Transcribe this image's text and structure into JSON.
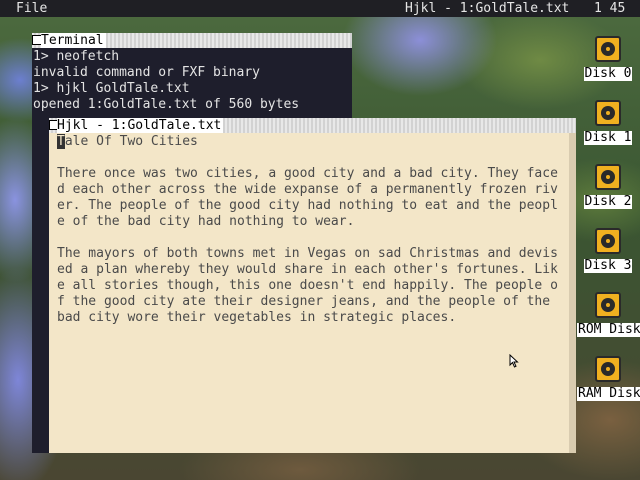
{
  "menubar": {
    "file_label": "File",
    "active_title": "Hjkl - 1:GoldTale.txt",
    "clock": "1 45"
  },
  "desktop_icons": [
    {
      "label": "Disk 0",
      "icon": "disk-icon"
    },
    {
      "label": "Disk 1",
      "icon": "disk-icon"
    },
    {
      "label": "Disk 2",
      "icon": "disk-icon"
    },
    {
      "label": "Disk 3",
      "icon": "disk-icon"
    },
    {
      "label": "ROM Disk",
      "icon": "disk-icon"
    },
    {
      "label": "RAM Disk",
      "icon": "disk-icon"
    }
  ],
  "terminal": {
    "title": "Terminal",
    "lines": [
      "1> neofetch",
      "invalid command or FXF binary",
      "1> hjkl GoldTale.txt",
      "opened 1:GoldTale.txt of 560 bytes"
    ]
  },
  "editor": {
    "title": "Hjkl - 1:GoldTale.txt",
    "cursor_char": "T",
    "first_line_rest": "ale Of Two Cities",
    "lines": [
      "",
      "There once was two cities, a good city and a bad city. They face",
      "d each other across the wide expanse of a permanently frozen riv",
      "er. The people of the good city had nothing to eat and the peopl",
      "e of the bad city had nothing to wear.",
      "",
      "The mayors of both towns met in Vegas on sad Christmas and devis",
      "ed a plan whereby they would share in each other's fortunes. Lik",
      "e all stories though, this one doesn't end happily. The people o",
      "f the good city ate their designer jeans, and the people of the",
      "bad city wore their vegetables in strategic places."
    ]
  },
  "colors": {
    "terminal_bg": "#1e1e2c",
    "editor_bg": "#f3e6c8",
    "menubar_bg": "#1f1f24",
    "disk_accent": "#f0b020"
  }
}
